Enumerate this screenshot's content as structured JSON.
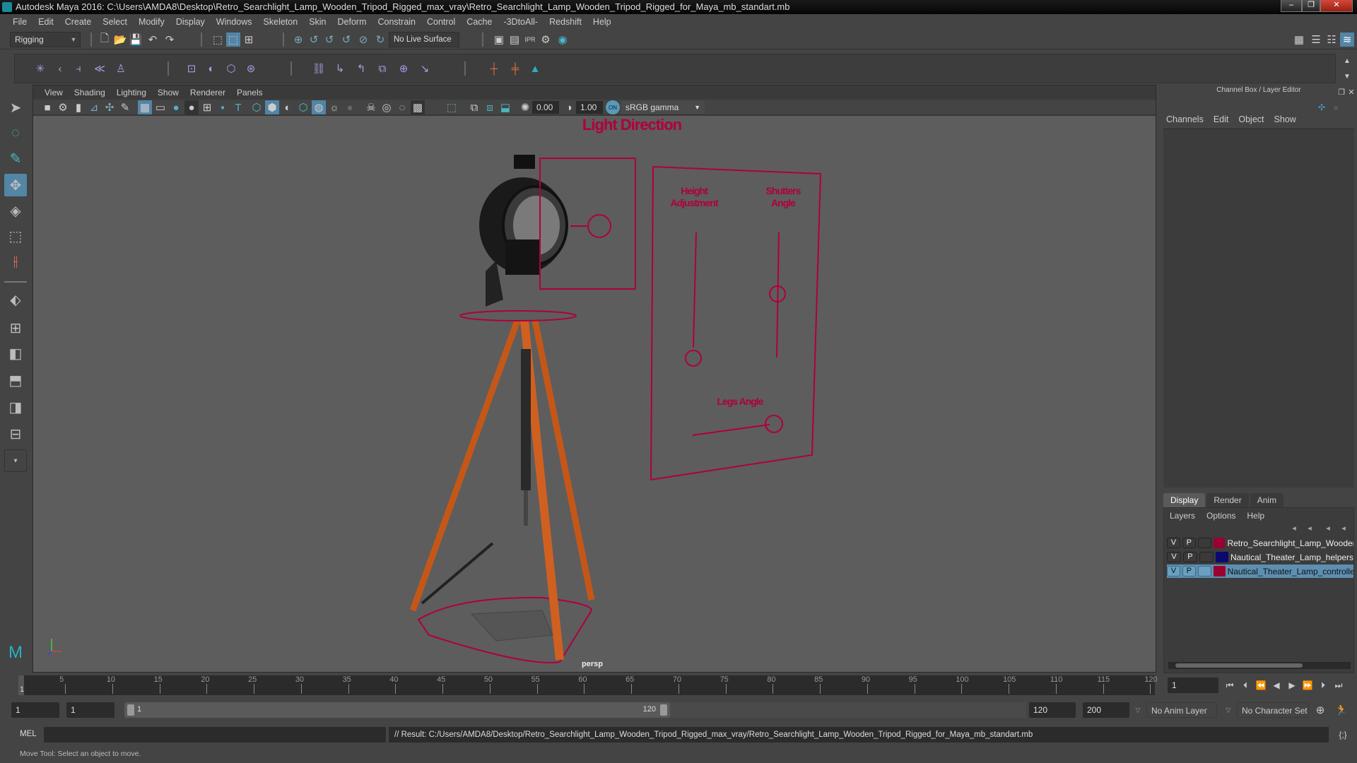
{
  "window": {
    "title": "Autodesk Maya 2016: C:\\Users\\AMDA8\\Desktop\\Retro_Searchlight_Lamp_Wooden_Tripod_Rigged_max_vray\\Retro_Searchlight_Lamp_Wooden_Tripod_Rigged_for_Maya_mb_standart.mb",
    "minimize": "–",
    "restore": "❐",
    "close": "✕"
  },
  "menubar": [
    "File",
    "Edit",
    "Create",
    "Select",
    "Modify",
    "Display",
    "Windows",
    "Skeleton",
    "Skin",
    "Deform",
    "Constrain",
    "Control",
    "Cache",
    "-3DtoAll-",
    "Redshift",
    "Help"
  ],
  "status_line": {
    "menu_set": "Rigging",
    "live_surface": "No Live Surface"
  },
  "viewport": {
    "menu": [
      "View",
      "Shading",
      "Lighting",
      "Show",
      "Renderer",
      "Panels"
    ],
    "exposure": "0.00",
    "gamma": "1.00",
    "color_mgmt_toggle": "ON",
    "color_space": "sRGB gamma",
    "camera_label": "persp",
    "controls": {
      "light_direction": "Light Direction",
      "height_adjustment": "Height Adjustment",
      "shutters_angle": "Shutters Angle",
      "legs_angle": "Legs Angle"
    },
    "accent_color": "#b0003a"
  },
  "channel_box": {
    "title": "Channel Box / Layer Editor",
    "menu": [
      "Channels",
      "Edit",
      "Object",
      "Show"
    ]
  },
  "layer_editor": {
    "tabs": [
      "Display",
      "Render",
      "Anim"
    ],
    "active_tab": "Display",
    "menu": [
      "Layers",
      "Options",
      "Help"
    ],
    "layers": [
      {
        "v": "V",
        "p": "P",
        "color": "#9a0030",
        "name": "Retro_Searchlight_Lamp_Wooden_",
        "selected": false
      },
      {
        "v": "V",
        "p": "P",
        "color": "#0a0a6e",
        "name": "Nautical_Theater_Lamp_helpers",
        "selected": false
      },
      {
        "v": "V",
        "p": "P",
        "color": "#9a0030",
        "name": "Nautical_Theater_Lamp_controllers",
        "selected": true
      }
    ]
  },
  "timeline": {
    "ticks": [
      "5",
      "10",
      "15",
      "20",
      "25",
      "30",
      "35",
      "40",
      "45",
      "50",
      "55",
      "60",
      "65",
      "70",
      "75",
      "80",
      "85",
      "90",
      "95",
      "100",
      "105",
      "110",
      "115",
      "120"
    ],
    "current_frame_marker": "1",
    "current_frame": "1",
    "range_min": 1,
    "range_max": 120
  },
  "range_slider": {
    "start": "1",
    "playback_start": "1",
    "slider_start_label": "1",
    "slider_end_label": "120",
    "playback_end": "120",
    "end": "200",
    "anim_layer": "No Anim Layer",
    "character_set": "No Character Set"
  },
  "command_line": {
    "language": "MEL",
    "input": "",
    "result": "// Result: C:/Users/AMDA8/Desktop/Retro_Searchlight_Lamp_Wooden_Tripod_Rigged_max_vray/Retro_Searchlight_Lamp_Wooden_Tripod_Rigged_for_Maya_mb_standart.mb"
  },
  "help_line": "Move Tool: Select an object to move."
}
